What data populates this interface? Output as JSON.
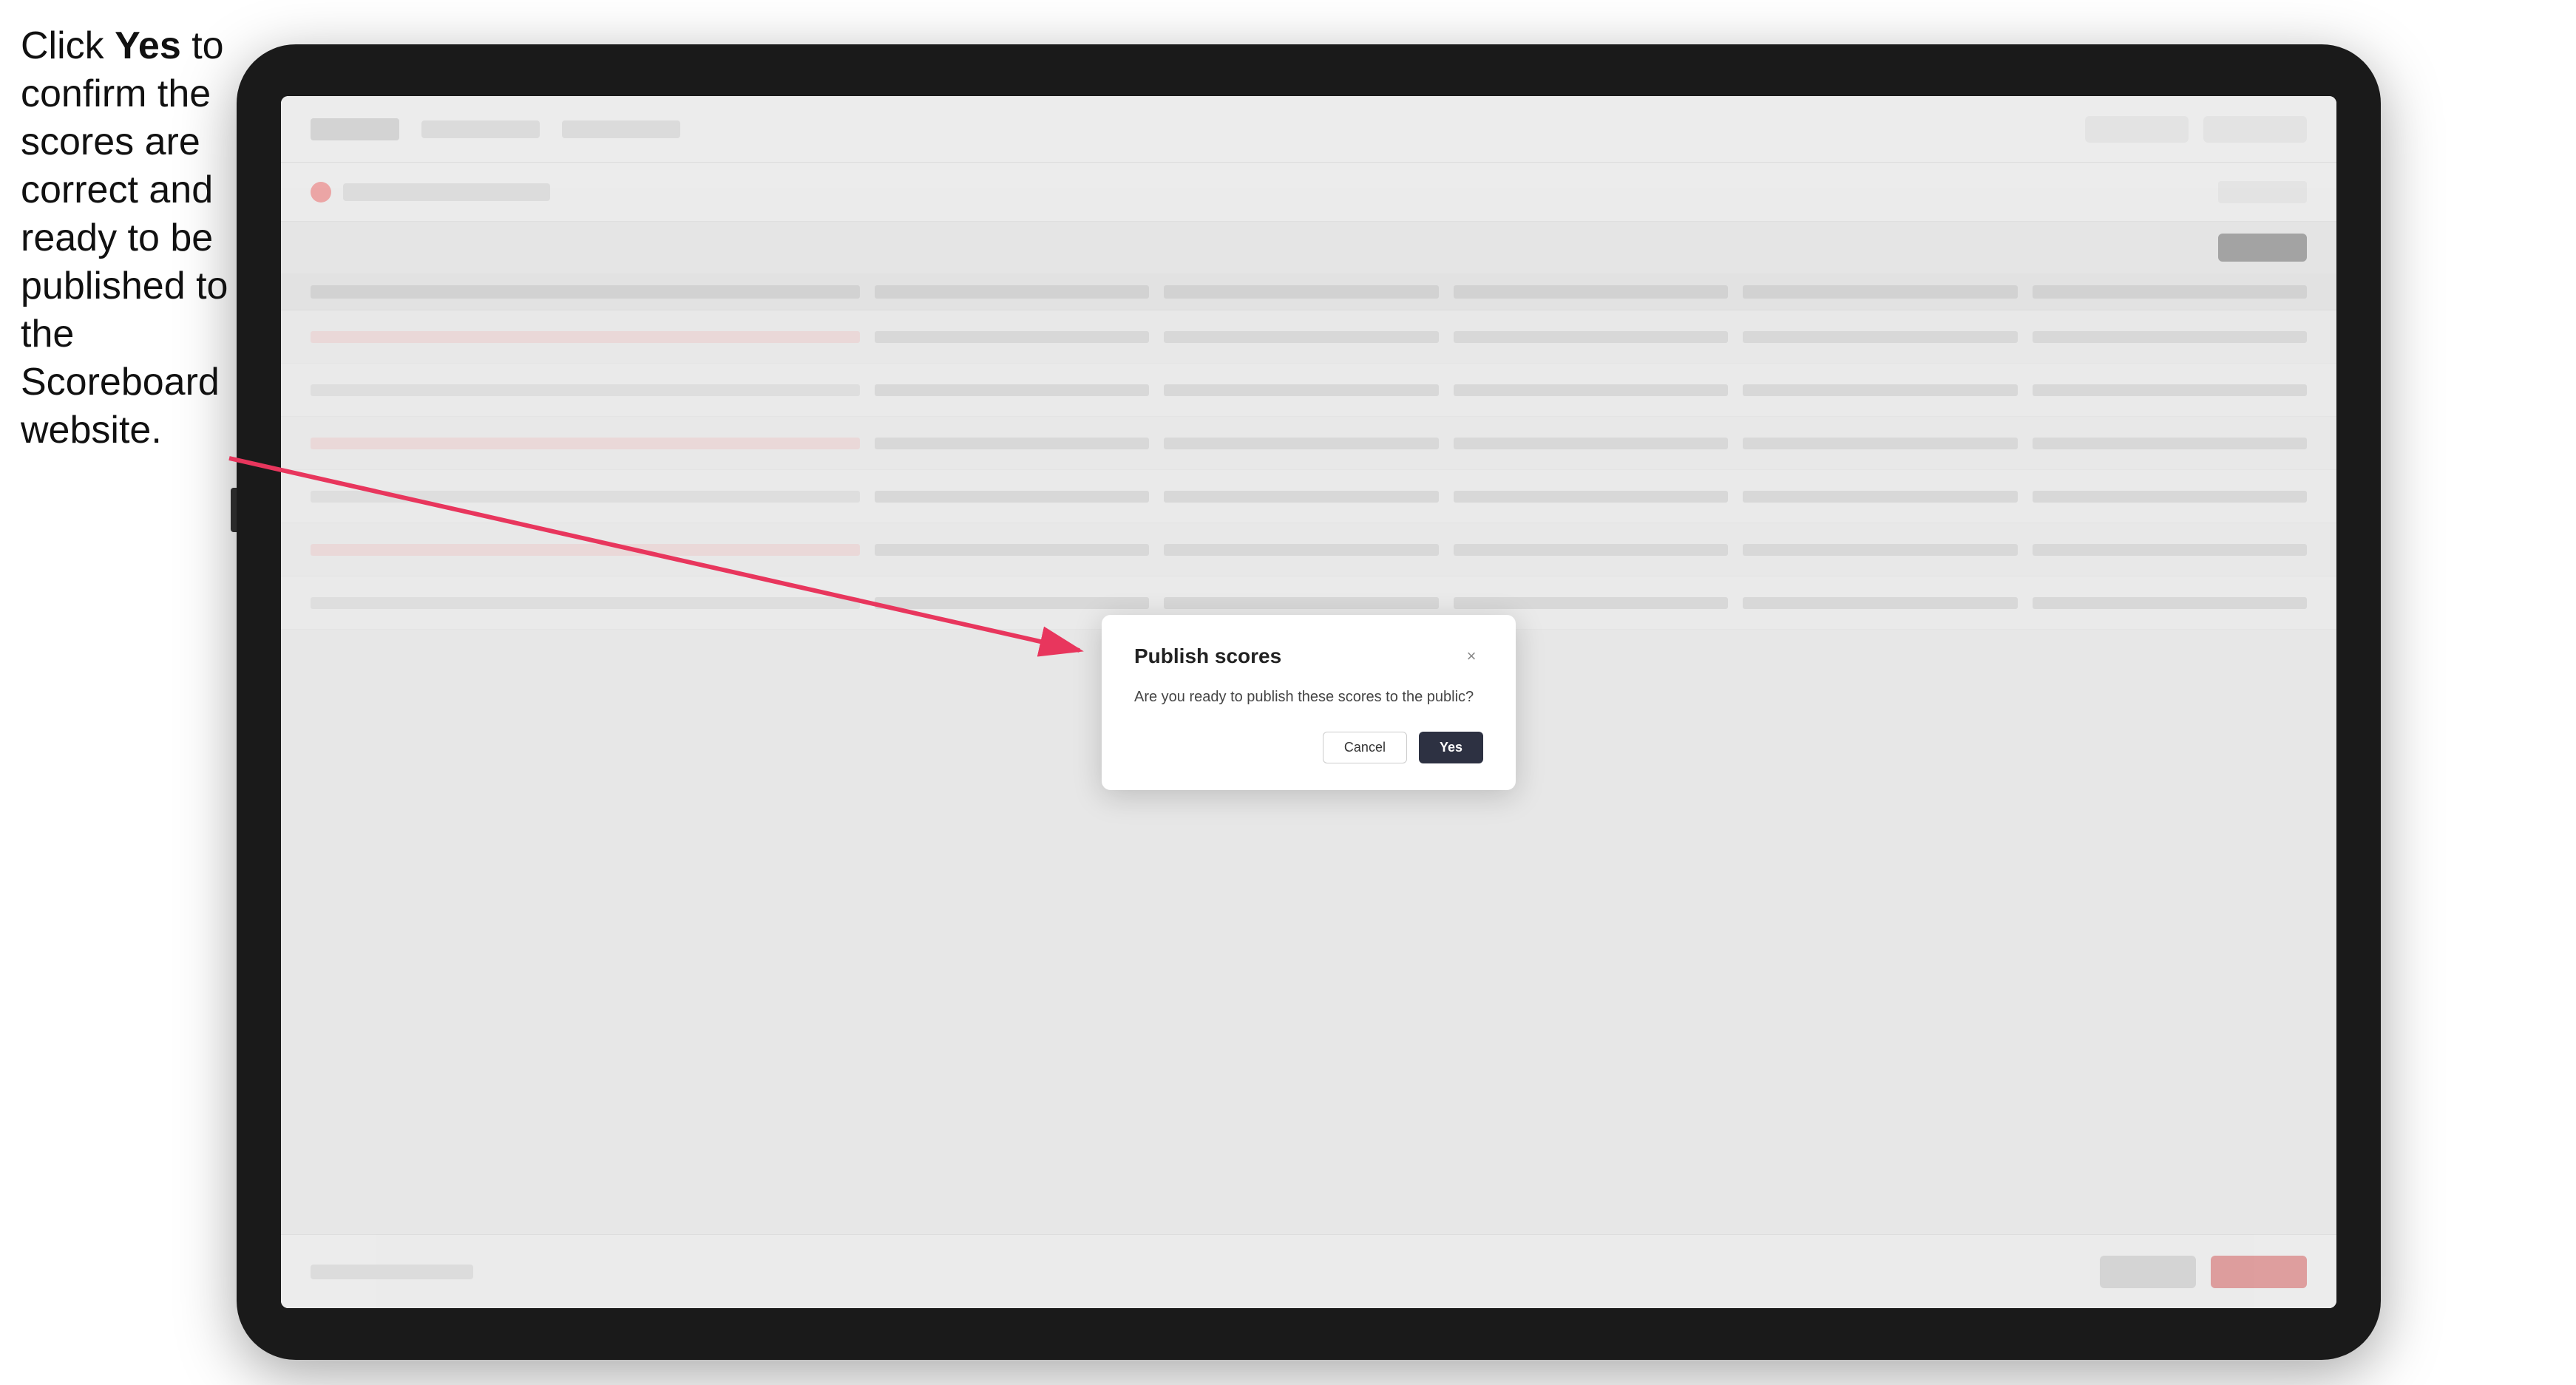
{
  "instruction": {
    "text_part1": "Click ",
    "bold": "Yes",
    "text_part2": " to confirm the scores are correct and ready to be published to the Scoreboard website."
  },
  "modal": {
    "title": "Publish scores",
    "body_text": "Are you ready to publish these scores to the public?",
    "cancel_label": "Cancel",
    "yes_label": "Yes",
    "close_icon": "×"
  },
  "colors": {
    "yes_button_bg": "#2d3142",
    "arrow_color": "#e8365d"
  }
}
